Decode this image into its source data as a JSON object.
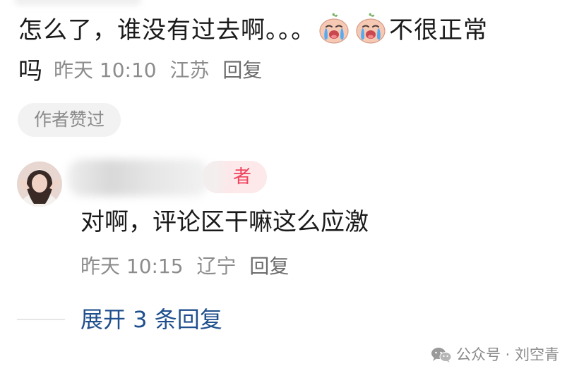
{
  "comment": {
    "text_main": "怎么了，谁没有过去啊。。。",
    "text_after_emoji": "不很正常",
    "text_wrap": "吗",
    "emoji": [
      "crying-face-emoji",
      "crying-face-emoji"
    ],
    "time": "昨天 10:10",
    "location": "江苏",
    "reply_label": "回复",
    "author_liked_label": "作者赞过"
  },
  "reply": {
    "badge_text": "者",
    "text": "对啊，评论区干嘛这么应激",
    "time": "昨天 10:15",
    "location": "辽宁",
    "reply_label": "回复"
  },
  "expand_label": "展开 3 条回复",
  "watermark": {
    "icon": "wechat-icon",
    "text": "公众号 · 刘空青"
  },
  "colors": {
    "meta_text": "#8c8c8c",
    "expand_link": "#1f4f8c",
    "author_badge_bg": "#fde8ea",
    "author_badge_text": "#f0445e",
    "liked_chip_bg": "#f2f2f2"
  }
}
